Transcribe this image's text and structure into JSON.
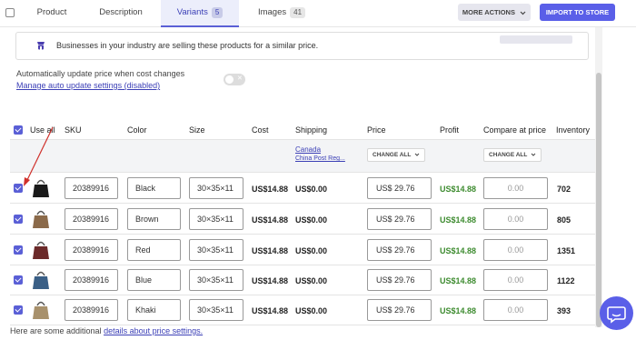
{
  "tabs": [
    {
      "label": "Product"
    },
    {
      "label": "Description"
    },
    {
      "label": "Variants",
      "count": "5"
    },
    {
      "label": "Images",
      "count": "41"
    }
  ],
  "actions": {
    "more": "MORE ACTIONS",
    "import": "IMPORT TO STORE"
  },
  "notice": {
    "text": "Businesses in your industry are selling these products for a similar price."
  },
  "auto_update": {
    "label": "Automatically update price when cost changes",
    "link": "Manage auto update settings (disabled)"
  },
  "table": {
    "headers": {
      "use_all": "Use all",
      "sku": "SKU",
      "color": "Color",
      "size": "Size",
      "cost": "Cost",
      "shipping": "Shipping",
      "price": "Price",
      "profit": "Profit",
      "compare": "Compare at price",
      "inventory": "Inventory"
    },
    "shipping_country": "Canada",
    "shipping_method": "China Post Reg...",
    "change_all": "CHANGE ALL",
    "rows": [
      {
        "sku": "20389916",
        "color": "Black",
        "size": "30×35×11",
        "cost": "US$14.88",
        "shipping": "US$0.00",
        "price": "US$  29.76",
        "profit": "US$14.88",
        "compare_placeholder": "0.00",
        "inventory": "702",
        "thumb_color": "#1a1a1a"
      },
      {
        "sku": "20389916",
        "color": "Brown",
        "size": "30×35×11",
        "cost": "US$14.88",
        "shipping": "US$0.00",
        "price": "US$  29.76",
        "profit": "US$14.88",
        "compare_placeholder": "0.00",
        "inventory": "805",
        "thumb_color": "#8b6a4a"
      },
      {
        "sku": "20389916",
        "color": "Red",
        "size": "30×35×11",
        "cost": "US$14.88",
        "shipping": "US$0.00",
        "price": "US$  29.76",
        "profit": "US$14.88",
        "compare_placeholder": "0.00",
        "inventory": "1351",
        "thumb_color": "#6b2a2a"
      },
      {
        "sku": "20389916",
        "color": "Blue",
        "size": "30×35×11",
        "cost": "US$14.88",
        "shipping": "US$0.00",
        "price": "US$  29.76",
        "profit": "US$14.88",
        "compare_placeholder": "0.00",
        "inventory": "1122",
        "thumb_color": "#3a5f86"
      },
      {
        "sku": "20389916",
        "color": "Khaki",
        "size": "30×35×11",
        "cost": "US$14.88",
        "shipping": "US$0.00",
        "price": "US$  29.76",
        "profit": "US$14.88",
        "compare_placeholder": "0.00",
        "inventory": "393",
        "thumb_color": "#a8916c"
      }
    ]
  },
  "footer": {
    "prefix": "Here are some additional ",
    "link": "details about price settings."
  },
  "colors": {
    "accent": "#5a5fe8",
    "profit": "#3d8b2f",
    "link": "#3b3fb6",
    "annotation_arrow": "#d0302b"
  },
  "icons": {
    "notice": "store-icon",
    "chat": "chat-icon",
    "dropdown": "chevron-down-icon"
  }
}
